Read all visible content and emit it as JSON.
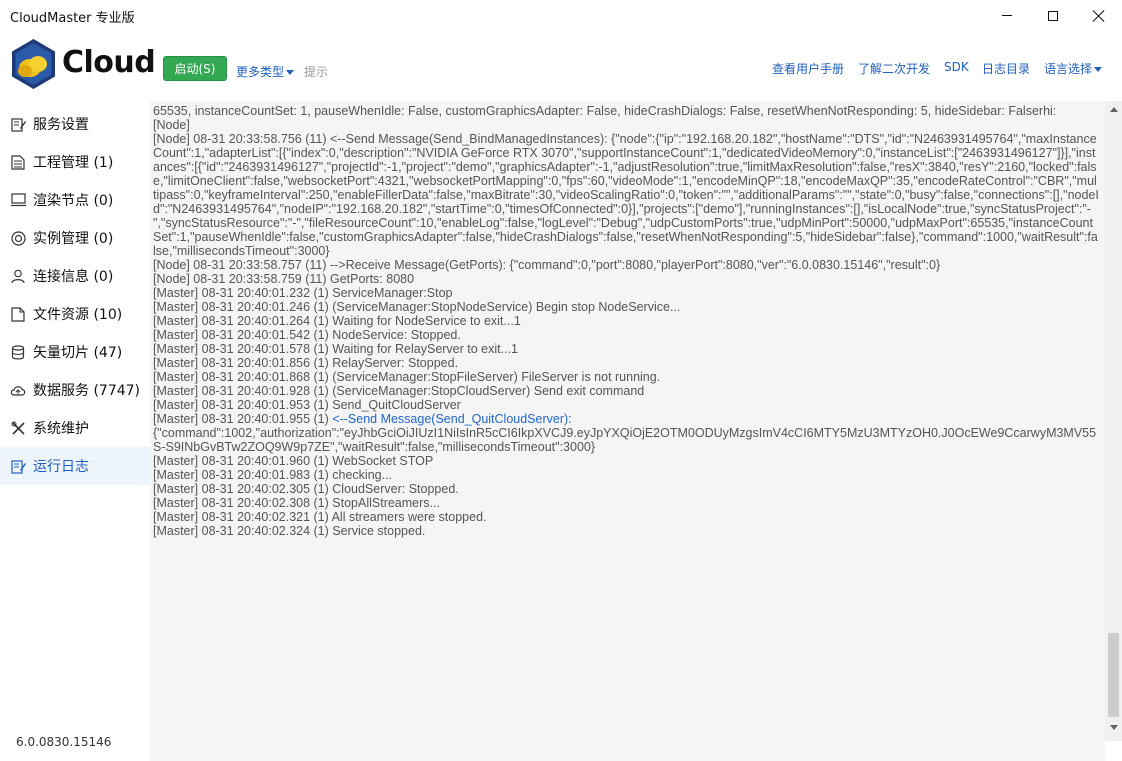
{
  "window": {
    "title": "CloudMaster 专业版"
  },
  "header": {
    "logo_text": "Cloud",
    "start_button": "启动(S)",
    "more_types": "更多类型",
    "hint": "提示",
    "links": {
      "manual": "查看用户手册",
      "secondary_dev": "了解二次开发",
      "sdk": "SDK",
      "log_dir": "日志目录",
      "language": "语言选择"
    }
  },
  "sidebar": {
    "items": [
      {
        "label": "服务设置",
        "icon": "settings-edit-icon"
      },
      {
        "label": "工程管理 (1)",
        "icon": "document-icon"
      },
      {
        "label": "渲染节点 (0)",
        "icon": "monitor-icon"
      },
      {
        "label": "实例管理 (0)",
        "icon": "instance-icon"
      },
      {
        "label": "连接信息 (0)",
        "icon": "user-icon"
      },
      {
        "label": "文件资源 (10)",
        "icon": "file-icon"
      },
      {
        "label": "矢量切片 (47)",
        "icon": "database-icon"
      },
      {
        "label": "数据服务 (7747)",
        "icon": "cloud-upload-icon"
      },
      {
        "label": "系统维护",
        "icon": "tools-icon"
      },
      {
        "label": "运行日志",
        "icon": "log-edit-icon"
      }
    ],
    "active_index": 9,
    "version": "6.0.0830.15146"
  },
  "log": {
    "lines": [
      {
        "text": "65535, instanceCountSet: 1, pauseWhenIdle: False, customGraphicsAdapter: False, hideCrashDialogs: False, resetWhenNotResponding: 5, hideSidebar: Falserhi:"
      },
      {
        "text": "[Node]"
      },
      {
        "text": "[Node] 08-31 20:33:58.756 (11) <--Send Message(Send_BindManagedInstances): {\"node\":{\"ip\":\"192.168.20.182\",\"hostName\":\"DTS\",\"id\":\"N2463931495764\",\"maxInstanceCount\":1,\"adapterList\":[{\"index\":0,\"description\":\"NVIDIA GeForce RTX 3070\",\"supportInstanceCount\":1,\"dedicatedVideoMemory\":0,\"instanceList\":[\"2463931496127\"]}],\"instances\":[{\"id\":\"2463931496127\",\"projectId\":-1,\"project\":\"demo\",\"graphicsAdapter\":-1,\"adjustResolution\":true,\"limitMaxResolution\":false,\"resX\":3840,\"resY\":2160,\"locked\":false,\"limitOneClient\":false,\"websocketPort\":4321,\"websocketPortMapping\":0,\"fps\":60,\"videoMode\":1,\"encodeMinQP\":18,\"encodeMaxQP\":35,\"encodeRateControl\":\"CBR\",\"multipass\":0,\"keyframeInterval\":250,\"enableFillerData\":false,\"maxBitrate\":30,\"videoScalingRatio\":0,\"token\":\"\",\"additionalParams\":\"\",\"state\":0,\"busy\":false,\"connections\":[],\"nodeId\":\"N2463931495764\",\"nodeIP\":\"192.168.20.182\",\"startTime\":0,\"timesOfConnected\":0}],\"projects\":[\"demo\"],\"runningInstances\":[],\"isLocalNode\":true,\"syncStatusProject\":\"-\",\"syncStatusResource\":\"-\",\"fileResourceCount\":10,\"enableLog\":false,\"logLevel\":\"Debug\",\"udpCustomPorts\":true,\"udpMinPort\":50000,\"udpMaxPort\":65535,\"instanceCountSet\":1,\"pauseWhenIdle\":false,\"customGraphicsAdapter\":false,\"hideCrashDialogs\":false,\"resetWhenNotResponding\":5,\"hideSidebar\":false},\"command\":1000,\"waitResult\":false,\"millisecondsTimeout\":3000}"
      },
      {
        "text": "[Node] 08-31 20:33:58.757 (11) -->Receive Message(GetPorts): {\"command\":0,\"port\":8080,\"playerPort\":8080,\"ver\":\"6.0.0830.15146\",\"result\":0}"
      },
      {
        "text": "[Node] 08-31 20:33:58.759 (11) GetPorts: 8080"
      },
      {
        "text": "[Master] 08-31 20:40:01.232 (1) ServiceManager:Stop"
      },
      {
        "text": "[Master] 08-31 20:40:01.246 (1) (ServiceManager:StopNodeService) Begin stop NodeService..."
      },
      {
        "text": "[Master] 08-31 20:40:01.264 (1) Waiting for NodeService to exit...1"
      },
      {
        "text": "[Master] 08-31 20:40:01.542 (1) NodeService: Stopped."
      },
      {
        "text": "[Master] 08-31 20:40:01.578 (1) Waiting for RelayServer to exit...1"
      },
      {
        "text": "[Master] 08-31 20:40:01.856 (1) RelayServer: Stopped."
      },
      {
        "text": "[Master] 08-31 20:40:01.868 (1) (ServiceManager:StopFileServer) FileServer is not running."
      },
      {
        "text": "[Master] 08-31 20:40:01.928 (1) (ServiceManager:StopCloudServer) Send exit command"
      },
      {
        "text": "[Master] 08-31 20:40:01.953 (1) Send_QuitCloudServer"
      },
      {
        "text": "[Master] 08-31 20:40:01.955 (1) ",
        "highlight": "<--Send Message(Send_QuitCloudServer):",
        "rest": "{\"command\":1002,\"authorization\":\"eyJhbGciOiJIUzI1NiIsInR5cCI6IkpXVCJ9.eyJpYXQiOjE2OTM0ODUyMzgsImV4cCI6MTY5MzU3MTYzOH0.J0OcEWe9CcarwyM3MV55S-S9INbGvBTw2ZOQ9W9p7ZE\",\"waitResult\":false,\"millisecondsTimeout\":3000}"
      },
      {
        "text": "[Master] 08-31 20:40:01.960 (1) WebSocket STOP"
      },
      {
        "text": "[Master] 08-31 20:40:01.983 (1) checking..."
      },
      {
        "text": "[Master] 08-31 20:40:02.305 (1) CloudServer: Stopped."
      },
      {
        "text": "[Master] 08-31 20:40:02.308 (1) StopAllStreamers..."
      },
      {
        "text": "[Master] 08-31 20:40:02.321 (1) All streamers were stopped."
      },
      {
        "text": "[Master] 08-31 20:40:02.324 (1) Service stopped."
      }
    ]
  },
  "colors": {
    "accent": "#1f5fbf",
    "start_green": "#32a852",
    "log_bg": "#f5f5f5",
    "active_nav_bg": "#eef4fb"
  }
}
